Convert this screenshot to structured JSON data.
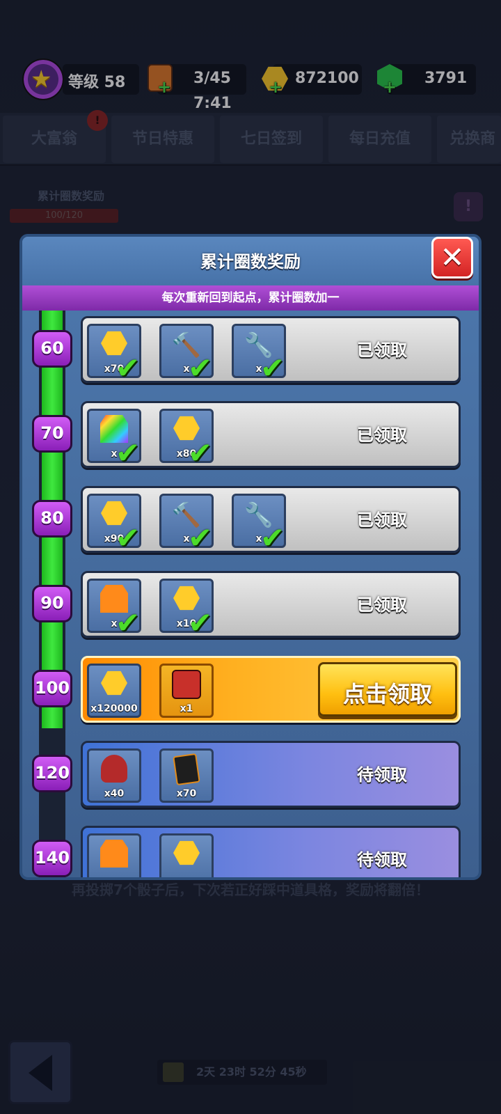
{
  "topbar": {
    "level": "等级 58",
    "energy": "3/45",
    "energy_timer": "7:41",
    "coins": "872100",
    "gems": "3791"
  },
  "tabs": [
    "大富翁",
    "节日特惠",
    "七日签到",
    "每日充值",
    "兑换商"
  ],
  "background": {
    "progress_label": "累计圈数奖励",
    "progress_value": "100/120",
    "footnote": "再投掷7个骰子后，下次若正好踩中道具格，奖励将翻倍！",
    "timer": "2天 23时 52分 45秒"
  },
  "modal": {
    "title": "累计圈数奖励",
    "subtitle": "每次重新回到起点，累计圈数加一",
    "rows": [
      {
        "lap": "60",
        "state": "done",
        "status": "已领取",
        "items": [
          {
            "icon": "coin-icon",
            "qty": "x70"
          },
          {
            "icon": "hammer-icon",
            "qty": "x"
          },
          {
            "icon": "wrench-icon",
            "qty": "x"
          }
        ]
      },
      {
        "lap": "70",
        "state": "done",
        "status": "已领取",
        "items": [
          {
            "icon": "rainbow-token-icon",
            "qty": "x"
          },
          {
            "icon": "coin-icon",
            "qty": "x80"
          }
        ]
      },
      {
        "lap": "80",
        "state": "done",
        "status": "已领取",
        "items": [
          {
            "icon": "coin-icon",
            "qty": "x90"
          },
          {
            "icon": "hammer-icon",
            "qty": "x"
          },
          {
            "icon": "wrench-icon",
            "qty": "x"
          }
        ]
      },
      {
        "lap": "90",
        "state": "done",
        "status": "已领取",
        "items": [
          {
            "icon": "orange-token-icon",
            "qty": "x"
          },
          {
            "icon": "coin-icon",
            "qty": "x10"
          }
        ]
      },
      {
        "lap": "100",
        "state": "ready",
        "status": "点击领取",
        "items": [
          {
            "icon": "coin-icon",
            "qty": "x120000"
          },
          {
            "icon": "pirate-hero-icon",
            "qty": "x1"
          }
        ]
      },
      {
        "lap": "120",
        "state": "pending",
        "status": "待领取",
        "items": [
          {
            "icon": "pirate-shard-icon",
            "qty": "x40"
          },
          {
            "icon": "cards-icon",
            "qty": "x70"
          }
        ]
      },
      {
        "lap": "140",
        "state": "pending",
        "status": "待领取",
        "items": [
          {
            "icon": "orange-token-icon",
            "qty": ""
          },
          {
            "icon": "coin-icon",
            "qty": ""
          }
        ]
      }
    ]
  }
}
